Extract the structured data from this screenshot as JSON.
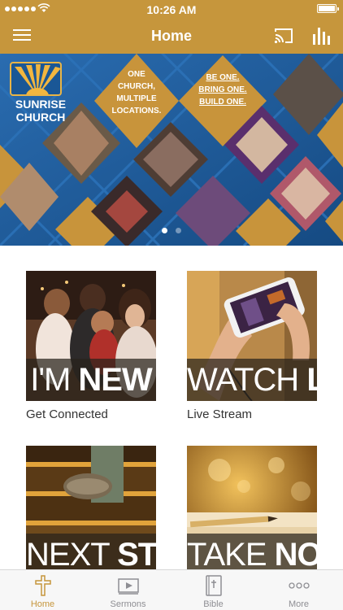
{
  "status": {
    "time": "10:26 AM"
  },
  "nav": {
    "title": "Home"
  },
  "banner": {
    "logo_line1": "SUNRISE",
    "logo_line2": "CHURCH",
    "tag1": [
      "ONE",
      "CHURCH,",
      "MULTIPLE",
      "LOCATIONS."
    ],
    "tag2": [
      "BE ONE.",
      "BRING ONE.",
      "BUILD ONE."
    ],
    "page_count": 2,
    "active_page": 1
  },
  "tiles": [
    {
      "title_light": "I'M ",
      "title_bold": "NEW",
      "label": "Get Connected"
    },
    {
      "title_light": "WATCH ",
      "title_bold": "LIVE",
      "label": "Live Stream"
    },
    {
      "title_light": "NEXT ",
      "title_bold": "STEP",
      "label": ""
    },
    {
      "title_light": "TAKE ",
      "title_bold": "NOTES",
      "label": ""
    }
  ],
  "tabs": [
    {
      "label": "Home",
      "icon": "cross-icon"
    },
    {
      "label": "Sermons",
      "icon": "video-icon"
    },
    {
      "label": "Bible",
      "icon": "book-icon"
    },
    {
      "label": "More",
      "icon": "ellipsis-icon"
    }
  ],
  "colors": {
    "brand": "#c6963c",
    "banner_blue": "#1a5796",
    "tab_inactive": "#8e8e93"
  }
}
